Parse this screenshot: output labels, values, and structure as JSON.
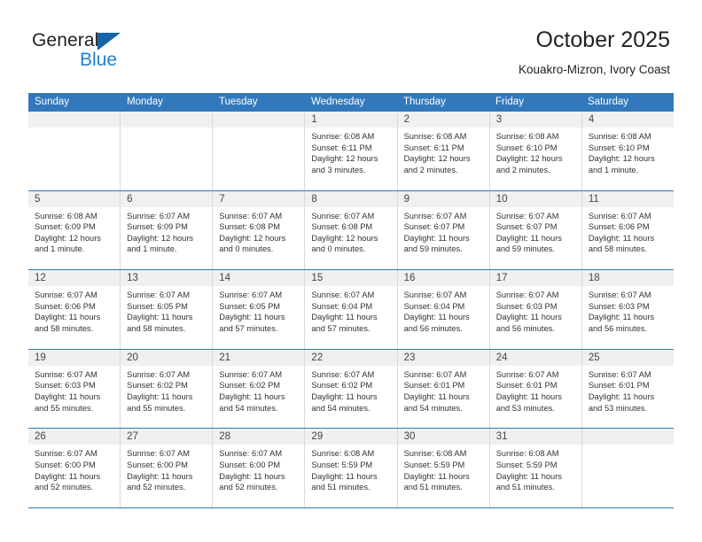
{
  "brand": {
    "name_part1": "General",
    "name_part2": "Blue",
    "triangle_color": "#1464aa",
    "blue_color": "#1f7fd4"
  },
  "header": {
    "title": "October 2025",
    "location": "Kouakro-Mizron, Ivory Coast"
  },
  "theme": {
    "header_row_bg": "#3179bc",
    "day_band_bg": "#f0f0f0",
    "grid_line": "#d9d9d9",
    "text": "#333333"
  },
  "weekdays": [
    "Sunday",
    "Monday",
    "Tuesday",
    "Wednesday",
    "Thursday",
    "Friday",
    "Saturday"
  ],
  "weeks": [
    [
      {
        "day": "",
        "empty": true,
        "sunrise": "",
        "sunset": "",
        "daylight1": "",
        "daylight2": ""
      },
      {
        "day": "",
        "empty": true,
        "sunrise": "",
        "sunset": "",
        "daylight1": "",
        "daylight2": ""
      },
      {
        "day": "",
        "empty": true,
        "sunrise": "",
        "sunset": "",
        "daylight1": "",
        "daylight2": ""
      },
      {
        "day": "1",
        "empty": false,
        "sunrise": "Sunrise: 6:08 AM",
        "sunset": "Sunset: 6:11 PM",
        "daylight1": "Daylight: 12 hours",
        "daylight2": "and 3 minutes."
      },
      {
        "day": "2",
        "empty": false,
        "sunrise": "Sunrise: 6:08 AM",
        "sunset": "Sunset: 6:11 PM",
        "daylight1": "Daylight: 12 hours",
        "daylight2": "and 2 minutes."
      },
      {
        "day": "3",
        "empty": false,
        "sunrise": "Sunrise: 6:08 AM",
        "sunset": "Sunset: 6:10 PM",
        "daylight1": "Daylight: 12 hours",
        "daylight2": "and 2 minutes."
      },
      {
        "day": "4",
        "empty": false,
        "sunrise": "Sunrise: 6:08 AM",
        "sunset": "Sunset: 6:10 PM",
        "daylight1": "Daylight: 12 hours",
        "daylight2": "and 1 minute."
      }
    ],
    [
      {
        "day": "5",
        "empty": false,
        "sunrise": "Sunrise: 6:08 AM",
        "sunset": "Sunset: 6:09 PM",
        "daylight1": "Daylight: 12 hours",
        "daylight2": "and 1 minute."
      },
      {
        "day": "6",
        "empty": false,
        "sunrise": "Sunrise: 6:07 AM",
        "sunset": "Sunset: 6:09 PM",
        "daylight1": "Daylight: 12 hours",
        "daylight2": "and 1 minute."
      },
      {
        "day": "7",
        "empty": false,
        "sunrise": "Sunrise: 6:07 AM",
        "sunset": "Sunset: 6:08 PM",
        "daylight1": "Daylight: 12 hours",
        "daylight2": "and 0 minutes."
      },
      {
        "day": "8",
        "empty": false,
        "sunrise": "Sunrise: 6:07 AM",
        "sunset": "Sunset: 6:08 PM",
        "daylight1": "Daylight: 12 hours",
        "daylight2": "and 0 minutes."
      },
      {
        "day": "9",
        "empty": false,
        "sunrise": "Sunrise: 6:07 AM",
        "sunset": "Sunset: 6:07 PM",
        "daylight1": "Daylight: 11 hours",
        "daylight2": "and 59 minutes."
      },
      {
        "day": "10",
        "empty": false,
        "sunrise": "Sunrise: 6:07 AM",
        "sunset": "Sunset: 6:07 PM",
        "daylight1": "Daylight: 11 hours",
        "daylight2": "and 59 minutes."
      },
      {
        "day": "11",
        "empty": false,
        "sunrise": "Sunrise: 6:07 AM",
        "sunset": "Sunset: 6:06 PM",
        "daylight1": "Daylight: 11 hours",
        "daylight2": "and 58 minutes."
      }
    ],
    [
      {
        "day": "12",
        "empty": false,
        "sunrise": "Sunrise: 6:07 AM",
        "sunset": "Sunset: 6:06 PM",
        "daylight1": "Daylight: 11 hours",
        "daylight2": "and 58 minutes."
      },
      {
        "day": "13",
        "empty": false,
        "sunrise": "Sunrise: 6:07 AM",
        "sunset": "Sunset: 6:05 PM",
        "daylight1": "Daylight: 11 hours",
        "daylight2": "and 58 minutes."
      },
      {
        "day": "14",
        "empty": false,
        "sunrise": "Sunrise: 6:07 AM",
        "sunset": "Sunset: 6:05 PM",
        "daylight1": "Daylight: 11 hours",
        "daylight2": "and 57 minutes."
      },
      {
        "day": "15",
        "empty": false,
        "sunrise": "Sunrise: 6:07 AM",
        "sunset": "Sunset: 6:04 PM",
        "daylight1": "Daylight: 11 hours",
        "daylight2": "and 57 minutes."
      },
      {
        "day": "16",
        "empty": false,
        "sunrise": "Sunrise: 6:07 AM",
        "sunset": "Sunset: 6:04 PM",
        "daylight1": "Daylight: 11 hours",
        "daylight2": "and 56 minutes."
      },
      {
        "day": "17",
        "empty": false,
        "sunrise": "Sunrise: 6:07 AM",
        "sunset": "Sunset: 6:03 PM",
        "daylight1": "Daylight: 11 hours",
        "daylight2": "and 56 minutes."
      },
      {
        "day": "18",
        "empty": false,
        "sunrise": "Sunrise: 6:07 AM",
        "sunset": "Sunset: 6:03 PM",
        "daylight1": "Daylight: 11 hours",
        "daylight2": "and 56 minutes."
      }
    ],
    [
      {
        "day": "19",
        "empty": false,
        "sunrise": "Sunrise: 6:07 AM",
        "sunset": "Sunset: 6:03 PM",
        "daylight1": "Daylight: 11 hours",
        "daylight2": "and 55 minutes."
      },
      {
        "day": "20",
        "empty": false,
        "sunrise": "Sunrise: 6:07 AM",
        "sunset": "Sunset: 6:02 PM",
        "daylight1": "Daylight: 11 hours",
        "daylight2": "and 55 minutes."
      },
      {
        "day": "21",
        "empty": false,
        "sunrise": "Sunrise: 6:07 AM",
        "sunset": "Sunset: 6:02 PM",
        "daylight1": "Daylight: 11 hours",
        "daylight2": "and 54 minutes."
      },
      {
        "day": "22",
        "empty": false,
        "sunrise": "Sunrise: 6:07 AM",
        "sunset": "Sunset: 6:02 PM",
        "daylight1": "Daylight: 11 hours",
        "daylight2": "and 54 minutes."
      },
      {
        "day": "23",
        "empty": false,
        "sunrise": "Sunrise: 6:07 AM",
        "sunset": "Sunset: 6:01 PM",
        "daylight1": "Daylight: 11 hours",
        "daylight2": "and 54 minutes."
      },
      {
        "day": "24",
        "empty": false,
        "sunrise": "Sunrise: 6:07 AM",
        "sunset": "Sunset: 6:01 PM",
        "daylight1": "Daylight: 11 hours",
        "daylight2": "and 53 minutes."
      },
      {
        "day": "25",
        "empty": false,
        "sunrise": "Sunrise: 6:07 AM",
        "sunset": "Sunset: 6:01 PM",
        "daylight1": "Daylight: 11 hours",
        "daylight2": "and 53 minutes."
      }
    ],
    [
      {
        "day": "26",
        "empty": false,
        "sunrise": "Sunrise: 6:07 AM",
        "sunset": "Sunset: 6:00 PM",
        "daylight1": "Daylight: 11 hours",
        "daylight2": "and 52 minutes."
      },
      {
        "day": "27",
        "empty": false,
        "sunrise": "Sunrise: 6:07 AM",
        "sunset": "Sunset: 6:00 PM",
        "daylight1": "Daylight: 11 hours",
        "daylight2": "and 52 minutes."
      },
      {
        "day": "28",
        "empty": false,
        "sunrise": "Sunrise: 6:07 AM",
        "sunset": "Sunset: 6:00 PM",
        "daylight1": "Daylight: 11 hours",
        "daylight2": "and 52 minutes."
      },
      {
        "day": "29",
        "empty": false,
        "sunrise": "Sunrise: 6:08 AM",
        "sunset": "Sunset: 5:59 PM",
        "daylight1": "Daylight: 11 hours",
        "daylight2": "and 51 minutes."
      },
      {
        "day": "30",
        "empty": false,
        "sunrise": "Sunrise: 6:08 AM",
        "sunset": "Sunset: 5:59 PM",
        "daylight1": "Daylight: 11 hours",
        "daylight2": "and 51 minutes."
      },
      {
        "day": "31",
        "empty": false,
        "sunrise": "Sunrise: 6:08 AM",
        "sunset": "Sunset: 5:59 PM",
        "daylight1": "Daylight: 11 hours",
        "daylight2": "and 51 minutes."
      },
      {
        "day": "",
        "empty": true,
        "sunrise": "",
        "sunset": "",
        "daylight1": "",
        "daylight2": ""
      }
    ]
  ]
}
